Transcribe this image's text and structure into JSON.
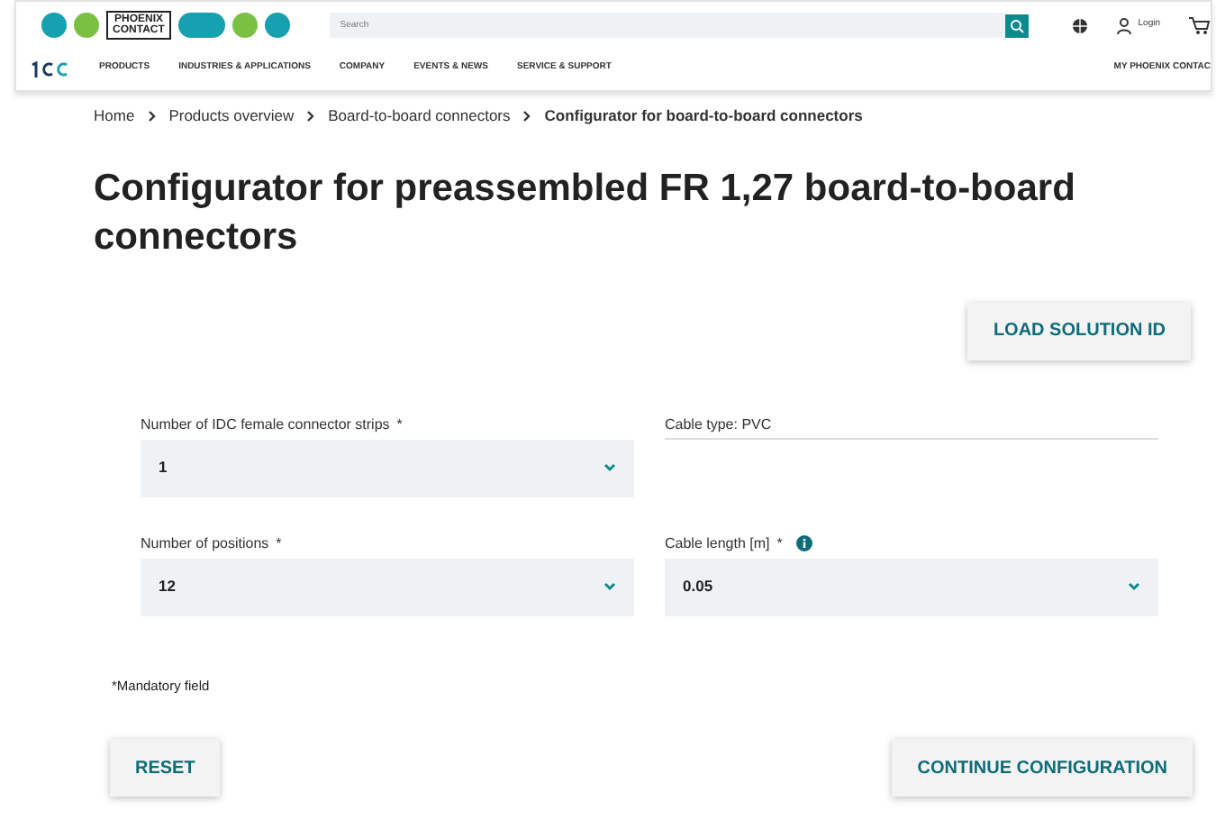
{
  "header": {
    "logo": "PHOENIX CONTACT",
    "search": {
      "placeholder": "Search"
    },
    "login": "Login"
  },
  "nav": {
    "items": [
      "PRODUCTS",
      "INDUSTRIES & APPLICATIONS",
      "COMPANY",
      "EVENTS & NEWS",
      "SERVICE & SUPPORT"
    ],
    "right": "MY PHOENIX CONTAC"
  },
  "breadcrumb": [
    "Home",
    "Products overview",
    "Board-to-board connectors",
    "Configurator for board-to-board connectors"
  ],
  "title": "Configurator for preassembled FR 1,27 board-to-board connectors",
  "load_button": "LOAD SOLUTION ID",
  "fields": [
    {
      "kind": "select",
      "label": "Number of IDC female connector strips",
      "required_mark": "*",
      "info": false,
      "value": "1"
    },
    {
      "kind": "text",
      "label": "Cable type: PVC",
      "info": false
    },
    {
      "kind": "select",
      "label": "Number of positions",
      "required_mark": "*",
      "info": false,
      "value": "12"
    },
    {
      "kind": "select",
      "label": "Cable length [m]",
      "required_mark": "*",
      "info": true,
      "value": "0.05"
    }
  ],
  "mandatory_note": "*Mandatory field",
  "buttons": [
    "RESET",
    "CONTINUE CONFIGURATION"
  ]
}
